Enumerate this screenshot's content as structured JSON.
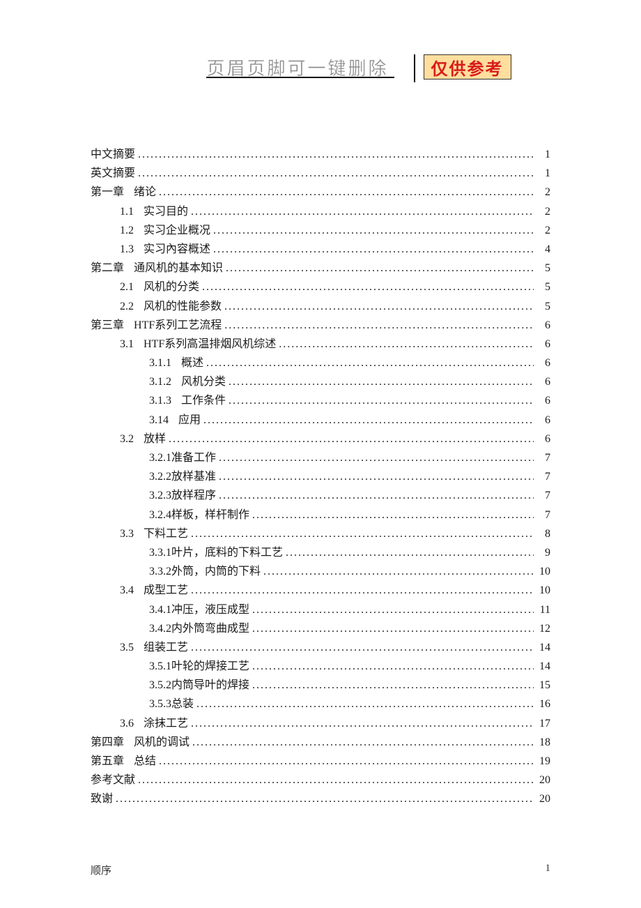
{
  "header": {
    "title": "页眉页脚可一键删除",
    "badge": "仅供参考"
  },
  "toc": [
    {
      "level": 0,
      "num": "",
      "label": "中文摘要",
      "page": "1"
    },
    {
      "level": 0,
      "num": "",
      "label": "英文摘要",
      "page": "1"
    },
    {
      "level": 0,
      "num": "第一章",
      "label": "绪论",
      "page": "2"
    },
    {
      "level": 1,
      "num": "1.1",
      "label": "实习目的",
      "page": "2"
    },
    {
      "level": 1,
      "num": "1.2",
      "label": "实习企业概况",
      "page": "2"
    },
    {
      "level": 1,
      "num": "1.3",
      "label": "实习內容概述",
      "page": "4"
    },
    {
      "level": 0,
      "num": "第二章",
      "label": "通风机的基本知识",
      "page": "5"
    },
    {
      "level": 1,
      "num": "2.1",
      "label": "风机的分类",
      "page": "5"
    },
    {
      "level": 1,
      "num": "2.2",
      "label": "风机的性能参数",
      "page": "5"
    },
    {
      "level": 0,
      "num": "第三章",
      "label": "HTF系列工艺流程",
      "page": "6"
    },
    {
      "level": 1,
      "num": "3.1",
      "label": "HTF系列高温排烟风机综述",
      "page": "6"
    },
    {
      "level": 2,
      "num": "3.1.1",
      "label": "概述",
      "page": "6"
    },
    {
      "level": 2,
      "num": "3.1.2",
      "label": "风机分类",
      "page": "6"
    },
    {
      "level": 2,
      "num": "3.1.3",
      "label": "工作条件",
      "page": "6"
    },
    {
      "level": 2,
      "num": "3.14",
      "label": "应用",
      "page": "6"
    },
    {
      "level": 1,
      "num": "3.2",
      "label": "放样",
      "page": "6"
    },
    {
      "level": 2,
      "num": "3.2.1准备工作",
      "label": "",
      "page": "7"
    },
    {
      "level": 2,
      "num": "3.2.2放样基准",
      "label": "",
      "page": "7"
    },
    {
      "level": 2,
      "num": "3.2.3放样程序",
      "label": "",
      "page": "7"
    },
    {
      "level": 2,
      "num": "3.2.4样板，样杆制作",
      "label": "",
      "page": "7"
    },
    {
      "level": 1,
      "num": "3.3",
      "label": "下料工艺",
      "page": "8"
    },
    {
      "level": 2,
      "num": "3.3.1叶片，底料的下料工艺",
      "label": "",
      "page": "9"
    },
    {
      "level": 2,
      "num": "3.3.2外筒，内筒的下料",
      "label": "",
      "page": "10"
    },
    {
      "level": 1,
      "num": "3.4",
      "label": "成型工艺",
      "page": "10"
    },
    {
      "level": 2,
      "num": "3.4.1冲压，液压成型",
      "label": "",
      "page": "11"
    },
    {
      "level": 2,
      "num": "3.4.2内外筒弯曲成型",
      "label": "",
      "page": "12"
    },
    {
      "level": 1,
      "num": "3.5",
      "label": "组装工艺",
      "page": "14"
    },
    {
      "level": 2,
      "num": "3.5.1叶轮的焊接工艺",
      "label": "",
      "page": "14"
    },
    {
      "level": 2,
      "num": "3.5.2内筒导叶的焊接",
      "label": "",
      "page": "15"
    },
    {
      "level": 2,
      "num": "3.5.3总装",
      "label": "",
      "page": "16"
    },
    {
      "level": 1,
      "num": "3.6",
      "label": "涂抹工艺",
      "page": "17"
    },
    {
      "level": 0,
      "num": "第四章",
      "label": "风机的调试",
      "page": "18"
    },
    {
      "level": 0,
      "num": "第五章",
      "label": "总结",
      "page": "19"
    },
    {
      "level": 0,
      "num": "",
      "label": "参考文献",
      "page": "20"
    },
    {
      "level": 0,
      "num": "",
      "label": "致谢",
      "page": "20"
    }
  ],
  "footer": {
    "left": "顺序",
    "right": "1"
  }
}
